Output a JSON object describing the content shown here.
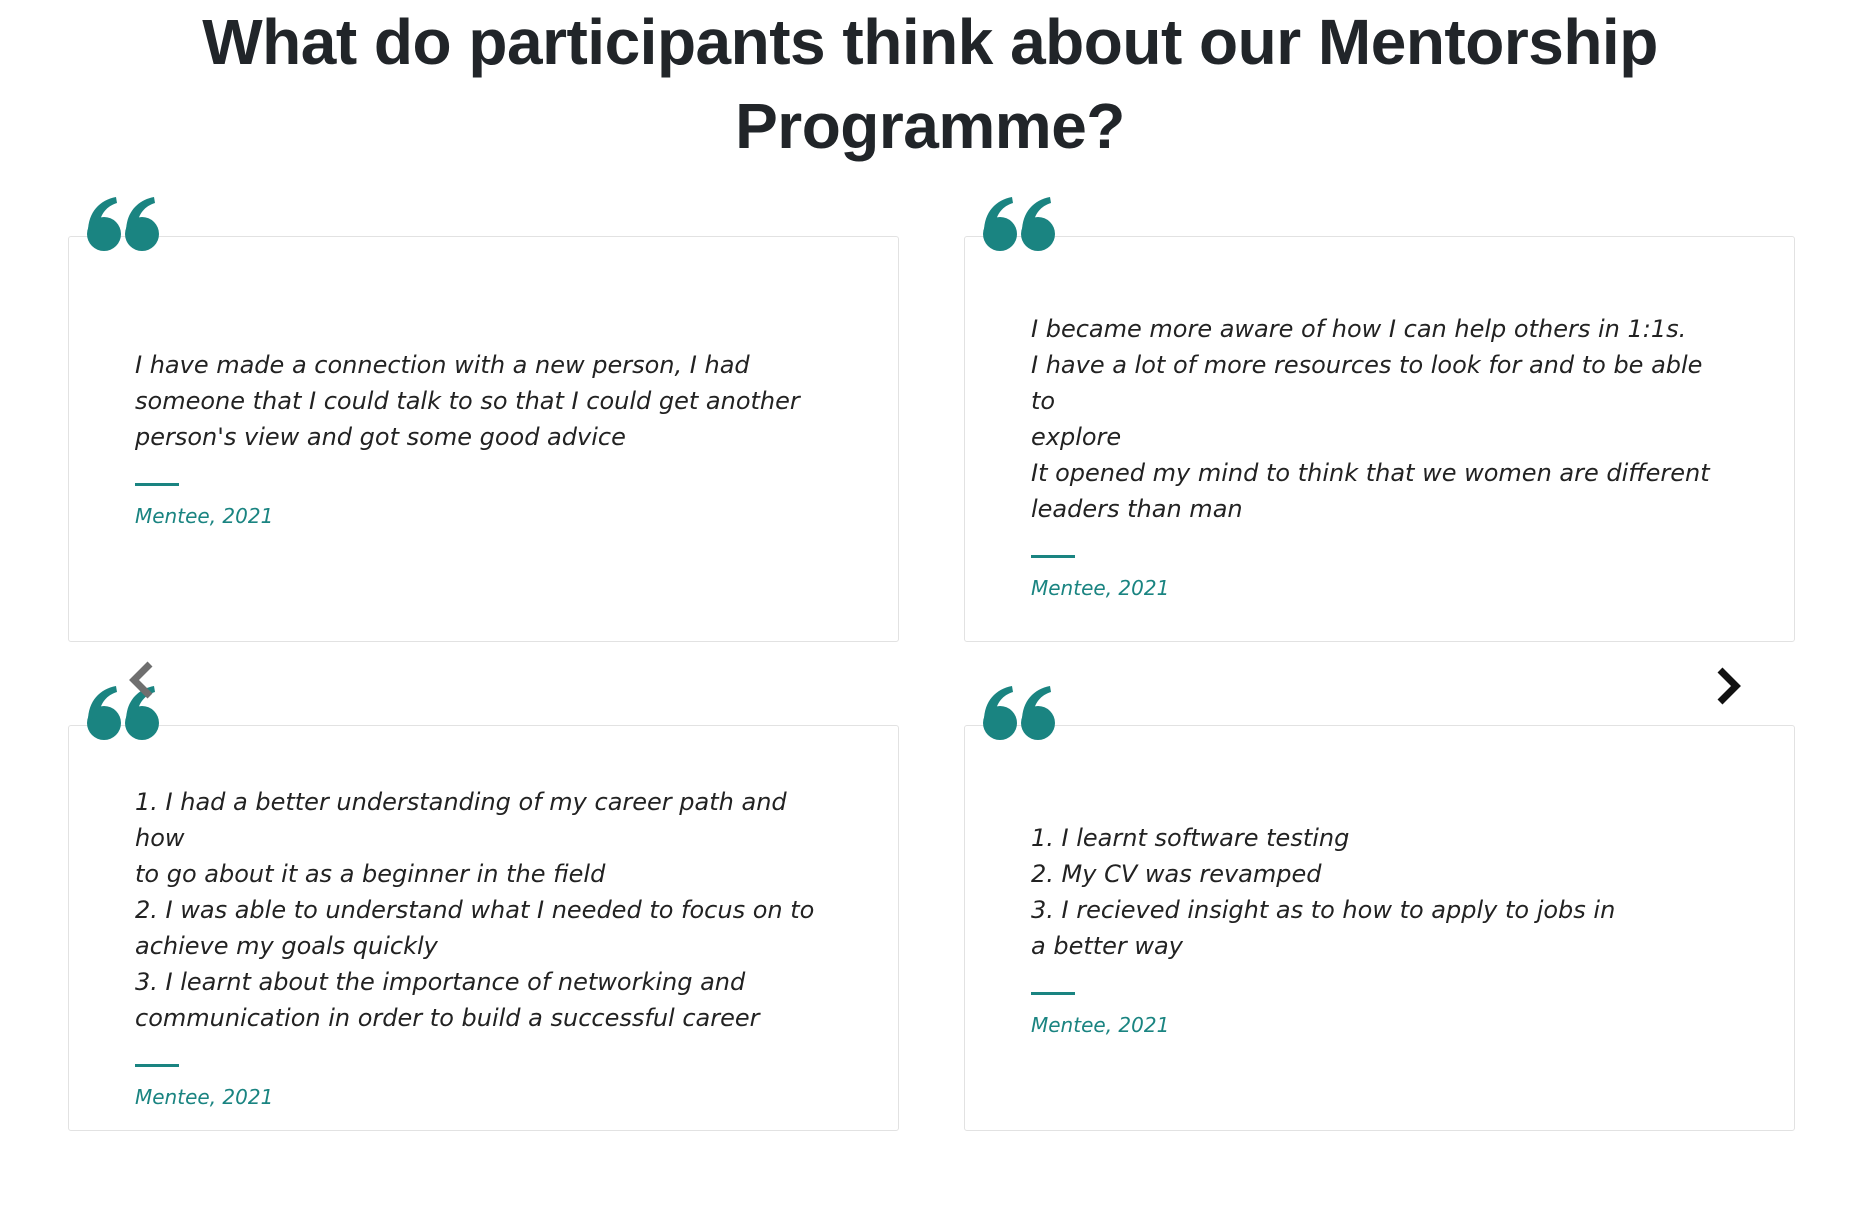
{
  "page": {
    "title": "What do participants think about our Mentorship Programme?"
  },
  "colors": {
    "accent": "#1a8481",
    "text": "#222222",
    "title": "#212529",
    "card_border": "#e2e2e2"
  },
  "carousel": {
    "prev_icon": "chevron-left-icon",
    "next_icon": "chevron-right-icon"
  },
  "testimonials": [
    {
      "icon": "quote-icon",
      "text": "I have made a connection with a new person, I had\nsomeone that I could talk to so that I could get another\nperson's view and got some good advice",
      "author": "Mentee, 2021"
    },
    {
      "icon": "quote-icon",
      "text": "I became more aware of how I can help others in 1:1s.\nI have a lot of more resources to look for and to be able to\nexplore\nIt opened my mind to think that we women are different\nleaders than man",
      "author": "Mentee, 2021"
    },
    {
      "icon": "quote-icon",
      "text": "1. I had a better understanding of my career path and how\nto go about it as a beginner in the field\n2. I was able to understand what I needed to focus on to\nachieve my goals quickly\n3. I learnt about the importance of networking and\ncommunication  in order to build a successful career",
      "author": "Mentee, 2021"
    },
    {
      "icon": "quote-icon",
      "text": "1. I learnt software testing\n2. My CV was revamped\n3. I recieved insight as to how to apply to jobs in\na better way",
      "author": "Mentee, 2021"
    }
  ]
}
